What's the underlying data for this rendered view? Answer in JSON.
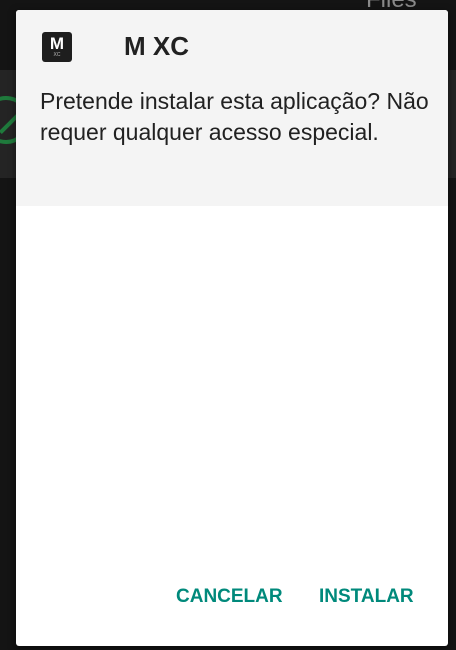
{
  "background": {
    "app_label": "Files",
    "check_icon": "check-circle-icon"
  },
  "dialog": {
    "app_icon": {
      "letter": "M",
      "sub": "XC"
    },
    "app_name": "M XC",
    "message": "Pretende instalar esta aplicação? Não requer qualquer acesso especial.",
    "buttons": {
      "cancel": "CANCELAR",
      "install": "INSTALAR"
    },
    "accent_color": "#00897b"
  }
}
